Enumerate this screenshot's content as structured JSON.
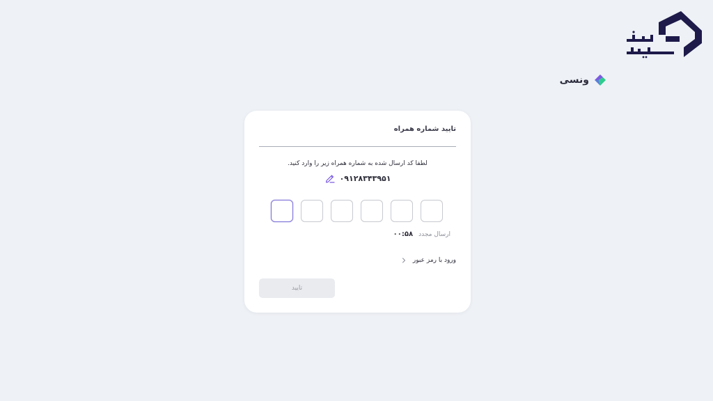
{
  "logo": {
    "icon": "khaneh-sarmayeh-logo",
    "text_top": "خانه",
    "text_bottom": "سرمایه",
    "color": "#1e1a4a"
  },
  "partner": {
    "name": "ونسی",
    "icon": "vancy-logo-icon",
    "colors": [
      "#7b5be0",
      "#2ecc8f"
    ]
  },
  "card": {
    "title": "تایید شماره همراه",
    "instruction": "لطفا کد ارسال شده به شماره همراه زیر را وارد کنید.",
    "phone_number": "۰۹۱۲۸۳۴۳۹۵۱",
    "edit_icon": "pencil-edit-icon",
    "otp": {
      "length": 6,
      "values": [
        "",
        "",
        "",
        "",
        "",
        ""
      ],
      "active_index": 0
    },
    "resend": {
      "label": "ارسال مجدد",
      "timer": "۰۰:۵۸"
    },
    "password_login": {
      "label": "ورود با رمز عبور",
      "icon": "chevron-right-icon"
    },
    "confirm_button": {
      "label": "تایید",
      "state": "disabled"
    }
  },
  "colors": {
    "background": "#eef1f5",
    "accent": "#7b6fd8",
    "card": "#ffffff"
  }
}
